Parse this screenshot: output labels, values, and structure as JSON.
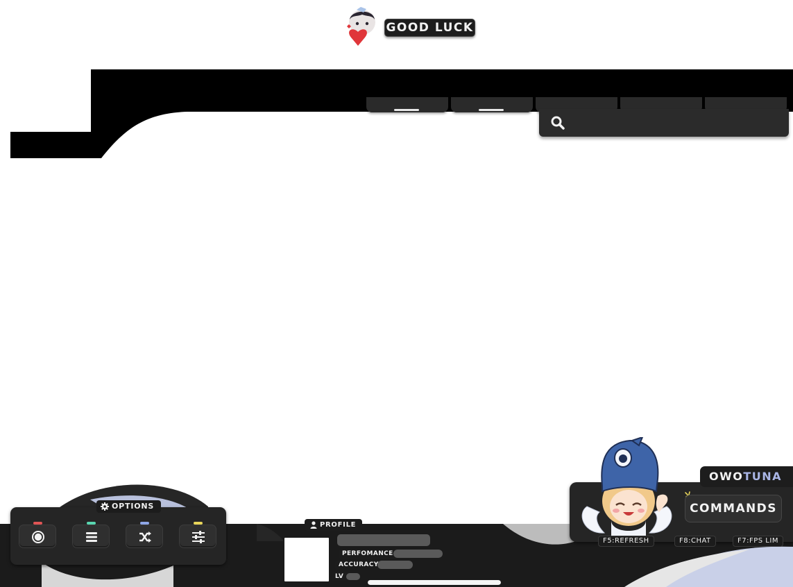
{
  "theme": {
    "panel": "#252525",
    "dark": "#1c1c1c",
    "accent_lavender": "#aab6e6",
    "wave_light": "#c9d0e8"
  },
  "header": {
    "greeting": "GOOD LUCK",
    "avatar_icon": "chibi-heart-avatar"
  },
  "tabs": [
    {
      "name": "tab-1"
    },
    {
      "name": "tab-2"
    },
    {
      "name": "tab-3"
    },
    {
      "name": "tab-4"
    },
    {
      "name": "tab-5"
    }
  ],
  "search": {
    "icon": "search-icon",
    "placeholder": ""
  },
  "options": {
    "label": "OPTIONS",
    "icon": "gear-icon",
    "buttons": [
      {
        "name": "record-button",
        "icon": "record-icon",
        "led": "#e05555"
      },
      {
        "name": "menu-button",
        "icon": "list-icon",
        "led": "#59d6b0"
      },
      {
        "name": "shuffle-button",
        "icon": "shuffle-icon",
        "led": "#8ea6e6"
      },
      {
        "name": "settings-button",
        "icon": "sliders-icon",
        "led": "#e8d55a"
      }
    ]
  },
  "profile": {
    "label": "PROFILE",
    "icon": "person-icon",
    "performance_label": "PERFOMANCE",
    "accuracy_label": "ACCURACY",
    "level_label": "LV",
    "progress": 1.0
  },
  "streamer": {
    "name_part1": "OWO",
    "name_part2": "TUNA",
    "commands_label": "COMMANDS",
    "hints": [
      "F5:REFRESH",
      "F8:CHAT",
      "F7:FPS LIM"
    ],
    "mascot_icon": "angel-fish-hat-mascot"
  }
}
